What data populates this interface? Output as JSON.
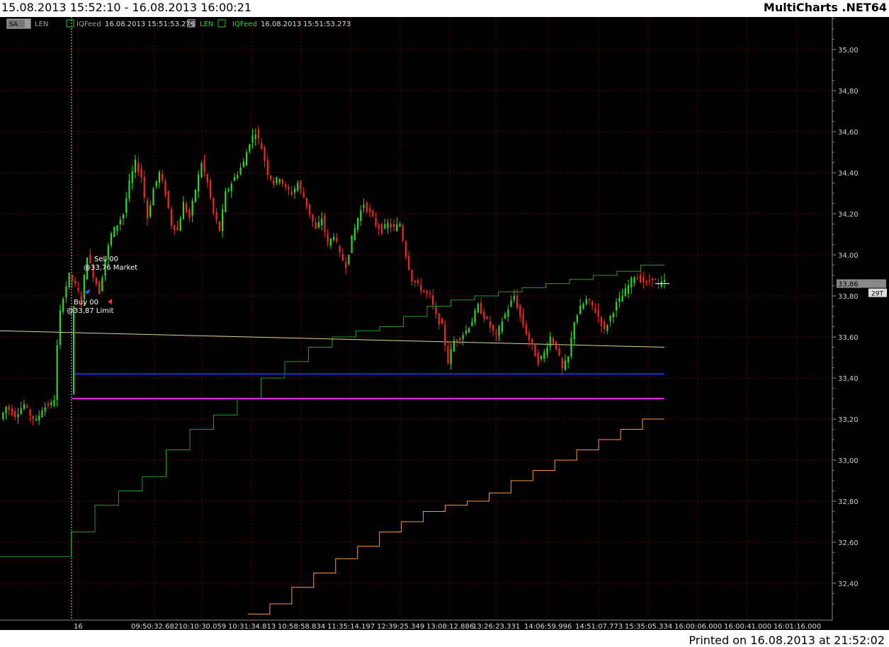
{
  "header": {
    "date_range": "15.08.2013 15:52:10 - 16.08.2013 16:00:21",
    "brand": "MultiCharts .NET64"
  },
  "legend": {
    "dropdown_label": "SA",
    "series1_symbol": "LEN",
    "series1_feed": "IQFeed",
    "series1_date": "16.08.2013",
    "series1_time": "15:51:53.273",
    "series2_symbol": "LEN",
    "series2_feed": "IQFeed",
    "series2_date": "16.08.2013",
    "series2_time": "15:51:53.273"
  },
  "price_marker": {
    "value": "33,86",
    "tick_count": "29T"
  },
  "orders": {
    "sell_label": "Sell  00",
    "sell_price": "@33,76 Market",
    "buy_label": "Buy  00",
    "buy_price": "@33,87 Limit"
  },
  "footer": {
    "printed": "Printed on 16.08.2013 at 21:52:02"
  },
  "colors": {
    "background": "#000000",
    "up_bar": "#22dd22",
    "down_bar": "#ff2222",
    "yellow_line": "#d8d88a",
    "blue_line": "#1a2ae0",
    "magenta_line": "#e020e0",
    "green_step": "#1f9a1f",
    "orange_step": "#ff9a30",
    "grid": "#6a0000"
  },
  "chart_data": {
    "type": "candlestick",
    "y_axis": {
      "range": [
        32.24,
        35.2
      ],
      "ticks": [
        "35,00",
        "34,80",
        "34,60",
        "34,40",
        "34,20",
        "34,00",
        "33,80",
        "33,60",
        "33,40",
        "33,20",
        "33,00",
        "32,80",
        "32,60",
        "32,40"
      ],
      "tick_values": [
        35.0,
        34.8,
        34.6,
        34.4,
        34.2,
        34.0,
        33.8,
        33.6,
        33.4,
        33.2,
        33.0,
        32.8,
        32.6,
        32.4
      ]
    },
    "x_axis": {
      "ticks": [
        "16",
        "09:50:32.682",
        "10:10:30.059",
        "10:31:34.813",
        "10:58:58.834",
        "11:35:14.197",
        "12:39:25.349",
        "13:08:12.886",
        "13:26:23.331",
        "14:06:59.996",
        "14:51:07.773",
        "15:35:05.334",
        "16:00:06.000",
        "16:00:41.000",
        "16:01:16.000"
      ]
    },
    "price_path": [
      [
        0,
        33.2
      ],
      [
        2,
        33.26
      ],
      [
        5,
        33.22
      ],
      [
        8,
        33.27
      ],
      [
        10,
        33.22
      ],
      [
        12,
        33.19
      ],
      [
        14,
        33.25
      ],
      [
        16,
        33.27
      ],
      [
        17,
        33.27
      ],
      [
        18,
        33.3
      ],
      [
        19,
        33.55
      ],
      [
        20,
        33.72
      ],
      [
        21,
        33.8
      ],
      [
        23,
        33.9
      ],
      [
        25,
        33.85
      ],
      [
        27,
        33.78
      ],
      [
        29,
        34.0
      ],
      [
        31,
        33.9
      ],
      [
        33,
        33.82
      ],
      [
        35,
        33.98
      ],
      [
        37,
        34.1
      ],
      [
        39,
        34.15
      ],
      [
        41,
        34.2
      ],
      [
        43,
        34.35
      ],
      [
        45,
        34.45
      ],
      [
        47,
        34.38
      ],
      [
        49,
        34.18
      ],
      [
        51,
        34.32
      ],
      [
        53,
        34.4
      ],
      [
        55,
        34.3
      ],
      [
        57,
        34.15
      ],
      [
        59,
        34.12
      ],
      [
        61,
        34.25
      ],
      [
        63,
        34.18
      ],
      [
        65,
        34.32
      ],
      [
        67,
        34.45
      ],
      [
        69,
        34.35
      ],
      [
        71,
        34.2
      ],
      [
        73,
        34.12
      ],
      [
        75,
        34.3
      ],
      [
        77,
        34.35
      ],
      [
        79,
        34.4
      ],
      [
        81,
        34.45
      ],
      [
        83,
        34.55
      ],
      [
        85,
        34.6
      ],
      [
        87,
        34.52
      ],
      [
        89,
        34.4
      ],
      [
        91,
        34.35
      ],
      [
        93,
        34.38
      ],
      [
        95,
        34.32
      ],
      [
        97,
        34.3
      ],
      [
        99,
        34.35
      ],
      [
        101,
        34.28
      ],
      [
        103,
        34.2
      ],
      [
        105,
        34.12
      ],
      [
        107,
        34.18
      ],
      [
        109,
        34.05
      ],
      [
        111,
        34.1
      ],
      [
        113,
        34.0
      ],
      [
        115,
        33.95
      ],
      [
        117,
        34.08
      ],
      [
        119,
        34.18
      ],
      [
        121,
        34.25
      ],
      [
        123,
        34.2
      ],
      [
        125,
        34.15
      ],
      [
        127,
        34.12
      ],
      [
        129,
        34.15
      ],
      [
        131,
        34.13
      ],
      [
        133,
        34.15
      ],
      [
        135,
        34.0
      ],
      [
        137,
        33.88
      ],
      [
        139,
        33.85
      ],
      [
        141,
        33.82
      ],
      [
        143,
        33.8
      ],
      [
        145,
        33.7
      ],
      [
        147,
        33.65
      ],
      [
        149,
        33.48
      ],
      [
        151,
        33.58
      ],
      [
        153,
        33.6
      ],
      [
        155,
        33.63
      ],
      [
        157,
        33.68
      ],
      [
        159,
        33.75
      ],
      [
        161,
        33.7
      ],
      [
        163,
        33.65
      ],
      [
        165,
        33.6
      ],
      [
        167,
        33.68
      ],
      [
        169,
        33.74
      ],
      [
        171,
        33.8
      ],
      [
        173,
        33.7
      ],
      [
        175,
        33.62
      ],
      [
        177,
        33.55
      ],
      [
        179,
        33.48
      ],
      [
        181,
        33.52
      ],
      [
        183,
        33.6
      ],
      [
        185,
        33.55
      ],
      [
        187,
        33.44
      ],
      [
        189,
        33.5
      ],
      [
        191,
        33.68
      ],
      [
        193,
        33.74
      ],
      [
        195,
        33.78
      ],
      [
        197,
        33.75
      ],
      [
        199,
        33.7
      ],
      [
        201,
        33.63
      ],
      [
        203,
        33.7
      ],
      [
        205,
        33.76
      ],
      [
        207,
        33.8
      ],
      [
        209,
        33.85
      ],
      [
        211,
        33.9
      ],
      [
        213,
        33.88
      ],
      [
        215,
        33.86
      ],
      [
        217,
        33.89
      ],
      [
        219,
        33.85
      ],
      [
        221,
        33.87
      ]
    ],
    "reference_lines": [
      {
        "label": "yellow",
        "start": 33.63,
        "end": 33.55
      },
      {
        "label": "blue",
        "value": 33.42
      },
      {
        "label": "magenta",
        "value": 33.3
      }
    ],
    "green_step": [
      32.53,
      32.53,
      32.53,
      32.65,
      32.78,
      32.85,
      32.92,
      33.05,
      33.15,
      33.22,
      33.3,
      33.4,
      33.48,
      33.55,
      33.6,
      33.63,
      33.65,
      33.7,
      33.75,
      33.78,
      33.8,
      33.82,
      33.84,
      33.86,
      33.88,
      33.9,
      33.92,
      33.95
    ],
    "orange_step": [
      32.25,
      32.3,
      32.38,
      32.45,
      32.52,
      32.58,
      32.65,
      32.7,
      32.75,
      32.78,
      32.8,
      32.84,
      32.9,
      32.95,
      33.0,
      33.05,
      33.1,
      33.15,
      33.2
    ]
  }
}
